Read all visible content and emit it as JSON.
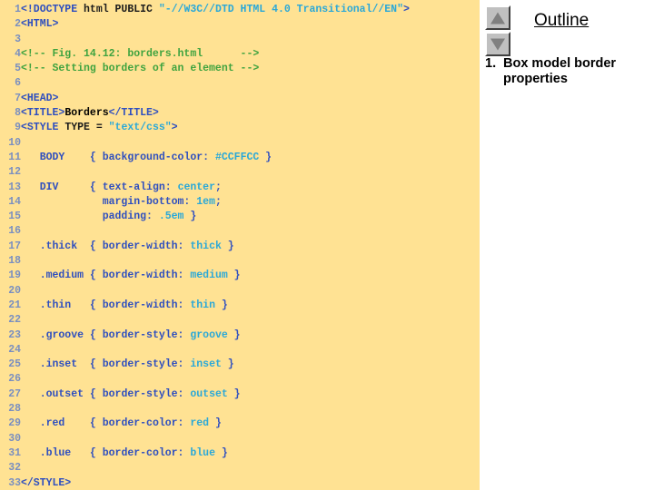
{
  "slide": {
    "background_color": "#FFFFFF",
    "code_panel_color": "#FFE293"
  },
  "code_panel": {
    "name": "html-source-listing",
    "lines": [
      {
        "number": "1",
        "segments": [
          {
            "t": "<!DOCTYPE",
            "c": "tag"
          },
          {
            "t": " html PUBLIC ",
            "c": "attr"
          },
          {
            "t": "\"-//W3C//DTD HTML 4.0 Transitional//EN\"",
            "c": "str"
          },
          {
            "t": ">",
            "c": "tag"
          }
        ]
      },
      {
        "number": "2",
        "segments": [
          {
            "t": "<HTML>",
            "c": "tag"
          }
        ]
      },
      {
        "number": "3",
        "segments": []
      },
      {
        "number": "4",
        "segments": [
          {
            "t": "<!-- Fig. 14.12: borders.html      -->",
            "c": "cmt"
          }
        ]
      },
      {
        "number": "5",
        "segments": [
          {
            "t": "<!-- Setting borders of an element -->",
            "c": "cmt"
          }
        ]
      },
      {
        "number": "6",
        "segments": []
      },
      {
        "number": "7",
        "segments": [
          {
            "t": "<HEAD>",
            "c": "tag"
          }
        ]
      },
      {
        "number": "8",
        "segments": [
          {
            "t": "<TITLE>",
            "c": "tag"
          },
          {
            "t": "Borders",
            "c": "txt"
          },
          {
            "t": "</TITLE>",
            "c": "tag"
          }
        ]
      },
      {
        "number": "9",
        "segments": [
          {
            "t": "<STYLE ",
            "c": "tag"
          },
          {
            "t": "TYPE",
            "c": "attr"
          },
          {
            "t": " = ",
            "c": "attr"
          },
          {
            "t": "\"text/css\"",
            "c": "str"
          },
          {
            "t": ">",
            "c": "tag"
          }
        ]
      },
      {
        "number": "10",
        "segments": []
      },
      {
        "number": "11",
        "segments": [
          {
            "t": "   BODY    ",
            "c": "sel"
          },
          {
            "t": "{ ",
            "c": "brace"
          },
          {
            "t": "background-color: ",
            "c": "prop"
          },
          {
            "t": "#CCFFCC",
            "c": "val"
          },
          {
            "t": " }",
            "c": "brace"
          }
        ]
      },
      {
        "number": "12",
        "segments": []
      },
      {
        "number": "13",
        "segments": [
          {
            "t": "   DIV     ",
            "c": "sel"
          },
          {
            "t": "{ ",
            "c": "brace"
          },
          {
            "t": "text-align: ",
            "c": "prop"
          },
          {
            "t": "center",
            "c": "val"
          },
          {
            "t": ";",
            "c": "brace"
          }
        ]
      },
      {
        "number": "14",
        "segments": [
          {
            "t": "             ",
            "c": "sel"
          },
          {
            "t": "margin-bottom: ",
            "c": "prop"
          },
          {
            "t": "1em",
            "c": "val"
          },
          {
            "t": ";",
            "c": "brace"
          }
        ]
      },
      {
        "number": "15",
        "segments": [
          {
            "t": "             ",
            "c": "sel"
          },
          {
            "t": "padding: ",
            "c": "prop"
          },
          {
            "t": ".5em",
            "c": "val"
          },
          {
            "t": " }",
            "c": "brace"
          }
        ]
      },
      {
        "number": "16",
        "segments": []
      },
      {
        "number": "17",
        "segments": [
          {
            "t": "   .thick  ",
            "c": "sel"
          },
          {
            "t": "{ ",
            "c": "brace"
          },
          {
            "t": "border-width: ",
            "c": "prop"
          },
          {
            "t": "thick",
            "c": "val"
          },
          {
            "t": " }",
            "c": "brace"
          }
        ]
      },
      {
        "number": "18",
        "segments": []
      },
      {
        "number": "19",
        "segments": [
          {
            "t": "   .medium ",
            "c": "sel"
          },
          {
            "t": "{ ",
            "c": "brace"
          },
          {
            "t": "border-width: ",
            "c": "prop"
          },
          {
            "t": "medium",
            "c": "val"
          },
          {
            "t": " }",
            "c": "brace"
          }
        ]
      },
      {
        "number": "20",
        "segments": []
      },
      {
        "number": "21",
        "segments": [
          {
            "t": "   .thin   ",
            "c": "sel"
          },
          {
            "t": "{ ",
            "c": "brace"
          },
          {
            "t": "border-width: ",
            "c": "prop"
          },
          {
            "t": "thin",
            "c": "val"
          },
          {
            "t": " }",
            "c": "brace"
          }
        ]
      },
      {
        "number": "22",
        "segments": []
      },
      {
        "number": "23",
        "segments": [
          {
            "t": "   .groove ",
            "c": "sel"
          },
          {
            "t": "{ ",
            "c": "brace"
          },
          {
            "t": "border-style: ",
            "c": "prop"
          },
          {
            "t": "groove",
            "c": "val"
          },
          {
            "t": " }",
            "c": "brace"
          }
        ]
      },
      {
        "number": "24",
        "segments": []
      },
      {
        "number": "25",
        "segments": [
          {
            "t": "   .inset  ",
            "c": "sel"
          },
          {
            "t": "{ ",
            "c": "brace"
          },
          {
            "t": "border-style: ",
            "c": "prop"
          },
          {
            "t": "inset",
            "c": "val"
          },
          {
            "t": " }",
            "c": "brace"
          }
        ]
      },
      {
        "number": "26",
        "segments": []
      },
      {
        "number": "27",
        "segments": [
          {
            "t": "   .outset ",
            "c": "sel"
          },
          {
            "t": "{ ",
            "c": "brace"
          },
          {
            "t": "border-style: ",
            "c": "prop"
          },
          {
            "t": "outset",
            "c": "val"
          },
          {
            "t": " }",
            "c": "brace"
          }
        ]
      },
      {
        "number": "28",
        "segments": []
      },
      {
        "number": "29",
        "segments": [
          {
            "t": "   .red    ",
            "c": "sel"
          },
          {
            "t": "{ ",
            "c": "brace"
          },
          {
            "t": "border-color: ",
            "c": "prop"
          },
          {
            "t": "red",
            "c": "val"
          },
          {
            "t": " }",
            "c": "brace"
          }
        ]
      },
      {
        "number": "30",
        "segments": []
      },
      {
        "number": "31",
        "segments": [
          {
            "t": "   .blue   ",
            "c": "sel"
          },
          {
            "t": "{ ",
            "c": "brace"
          },
          {
            "t": "border-color: ",
            "c": "prop"
          },
          {
            "t": "blue",
            "c": "val"
          },
          {
            "t": " }",
            "c": "brace"
          }
        ]
      },
      {
        "number": "32",
        "segments": []
      },
      {
        "number": "33",
        "segments": [
          {
            "t": "</STYLE>",
            "c": "tag"
          }
        ]
      }
    ]
  },
  "outline": {
    "title": "Outline",
    "nav": {
      "up_icon": "triangle-up-icon",
      "down_icon": "triangle-down-icon"
    },
    "items": [
      {
        "number": "1.",
        "text": "Box model border properties"
      }
    ]
  },
  "colors": {
    "code_background": "#FFE293",
    "tag": "#2F4FBF",
    "string": "#2AA8D8",
    "comment": "#3FA33F",
    "line_number": "#7A8FC0",
    "text": "#000000",
    "button_face": "#C0C0C0"
  }
}
